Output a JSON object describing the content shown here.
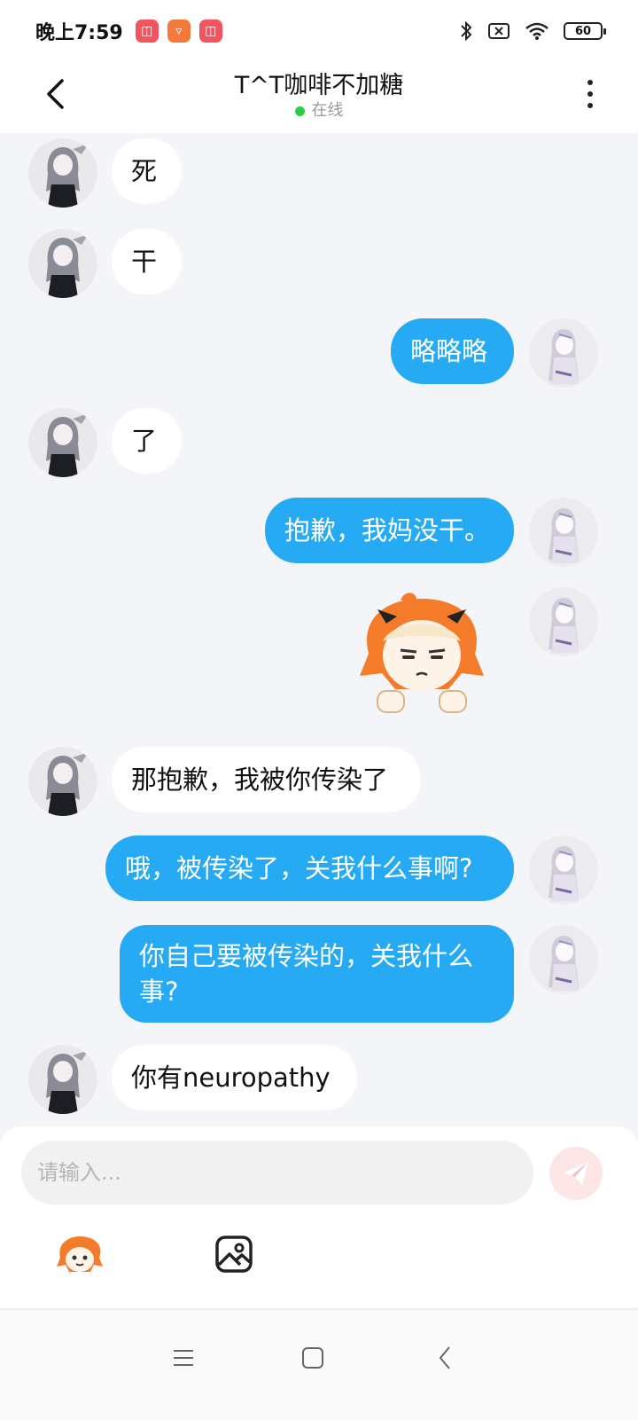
{
  "status_bar": {
    "time": "晚上7:59",
    "battery": "60",
    "icons": [
      "app-notification-icon",
      "app-notification-icon",
      "app-notification-icon",
      "bluetooth-icon",
      "no-sim-icon",
      "wifi-icon",
      "battery-icon"
    ]
  },
  "header": {
    "title": "T^T咖啡不加糖",
    "presence": "在线"
  },
  "messages": [
    {
      "from": "other",
      "text": "死"
    },
    {
      "from": "other",
      "text": "干"
    },
    {
      "from": "me",
      "text": "略略略"
    },
    {
      "from": "other",
      "text": "了"
    },
    {
      "from": "me",
      "text": "抱歉，我妈没干。"
    },
    {
      "from": "me",
      "type": "sticker",
      "sticker": "grumpy-orange-hair-sticker"
    },
    {
      "from": "other",
      "text": "那抱歉，我被你传染了"
    },
    {
      "from": "me",
      "text": "哦，被传染了，关我什么事啊?"
    },
    {
      "from": "me",
      "text": "你自己要被传染的，关我什么事?"
    },
    {
      "from": "other",
      "text": "你有neuropathy"
    }
  ],
  "composer": {
    "placeholder": "请输入...",
    "send_icon": "send-icon",
    "tools": [
      "emoji-sticker-icon",
      "image-icon"
    ]
  },
  "nav_bar": {
    "buttons": [
      "menu-icon",
      "home-icon",
      "back-icon"
    ]
  },
  "colors": {
    "outgoing_bubble": "#26aaf4",
    "incoming_bubble": "#ffffff",
    "background": "#f4f5f8",
    "online_dot": "#2ecc40"
  }
}
